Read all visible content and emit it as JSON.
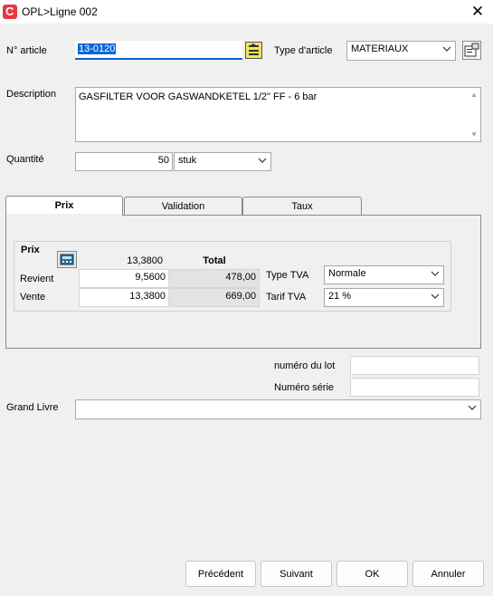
{
  "window": {
    "title": "OPL>Ligne   002",
    "app_icon_letter": "C",
    "close": "✕"
  },
  "form": {
    "article_label": "N° article",
    "article_value": "13-0120",
    "type_label": "Type d'article",
    "type_value": "MATERIAUX",
    "description_label": "Description",
    "description_value": "GASFILTER VOOR GASWANDKETEL 1/2\" FF - 6 bar",
    "quantite_label": "Quantité",
    "quantite_value": "50",
    "unit_value": "stuk"
  },
  "tabs": [
    {
      "label": "Prix",
      "active": true
    },
    {
      "label": "Validation",
      "active": false
    },
    {
      "label": "Taux",
      "active": false
    }
  ],
  "prix": {
    "section_label": "Prix",
    "header_value": "13,3800",
    "total_label": "Total",
    "revient_label": "Revient",
    "revient_value": "9,5600",
    "revient_total": "478,00",
    "vente_label": "Vente",
    "vente_value": "13,3800",
    "vente_total": "669,00",
    "type_tva_label": "Type TVA",
    "type_tva_value": "Normale",
    "tarif_tva_label": "Tarif TVA",
    "tarif_tva_value": "21 %"
  },
  "extra": {
    "lot_label": "numéro du lot",
    "lot_value": "",
    "serie_label": "Numéro série",
    "serie_value": "",
    "grand_livre_label": "Grand Livre",
    "grand_livre_value": ""
  },
  "buttons": {
    "precedent": "Précédent",
    "suivant": "Suivant",
    "ok": "OK",
    "annuler": "Annuler"
  },
  "icons": {
    "lookup": "lookup-icon",
    "properties": "properties-icon",
    "calculator": "calculator-icon",
    "chevron": "chevron-down-icon"
  },
  "colors": {
    "selection": "#0a64d6",
    "app_icon": "#e8383d",
    "lookup_yellow": "#f2e35c"
  }
}
